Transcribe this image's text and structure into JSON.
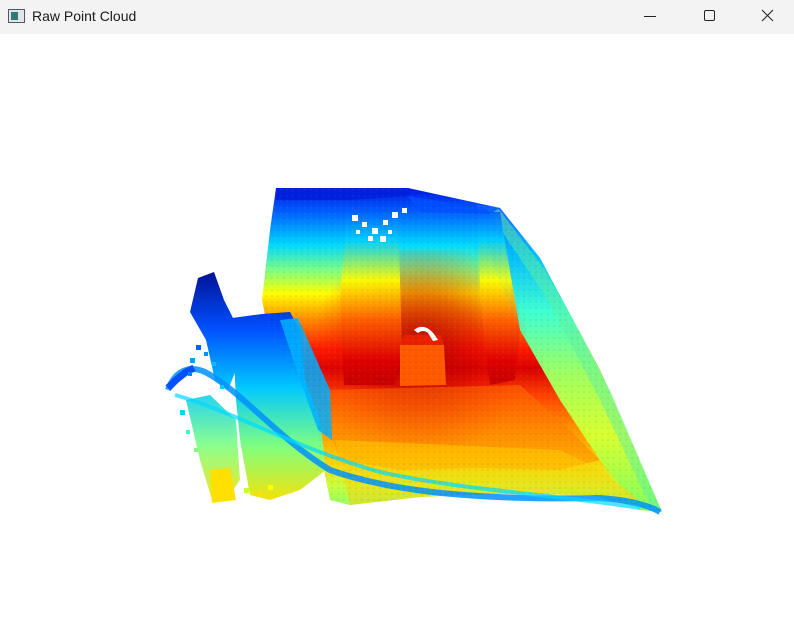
{
  "window": {
    "title": "Raw Point Cloud",
    "app_icon": "window-app-icon",
    "controls": {
      "minimize_icon": "minimize-icon",
      "maximize_icon": "maximize-icon",
      "close_icon": "close-icon"
    }
  },
  "viewport": {
    "content": "point-cloud-render",
    "background_color": "#ffffff",
    "colormap": [
      "#00008f",
      "#0040ff",
      "#00c8ff",
      "#7dff7a",
      "#ffff00",
      "#ff8000",
      "#e00000",
      "#7f0000"
    ]
  }
}
